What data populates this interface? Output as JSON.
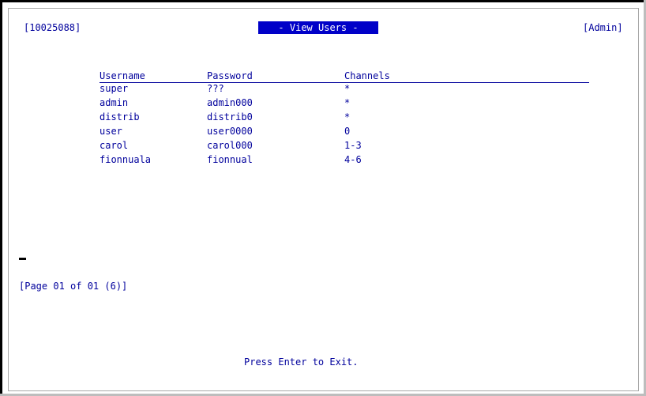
{
  "screen": {
    "serial": "[10025088]",
    "title": "- View Users -",
    "role": "[Admin]",
    "columns": {
      "username": "Username",
      "password": "Password",
      "channels": "Channels"
    },
    "rows": [
      {
        "username": "super",
        "password": "???",
        "channels": "*"
      },
      {
        "username": "admin",
        "password": "admin000",
        "channels": "*"
      },
      {
        "username": "distrib",
        "password": "distrib0",
        "channels": "*"
      },
      {
        "username": "user",
        "password": "user0000",
        "channels": "0"
      },
      {
        "username": "carol",
        "password": "carol000",
        "channels": "1-3"
      },
      {
        "username": "fionnuala",
        "password": "fionnual",
        "channels": "4-6"
      }
    ],
    "page_info": "[Page 01 of 01 (6)]",
    "footer": "Press Enter to Exit."
  },
  "colors": {
    "text": "#00009c",
    "title_bg": "#0000c8",
    "title_fg": "#ffffff"
  }
}
